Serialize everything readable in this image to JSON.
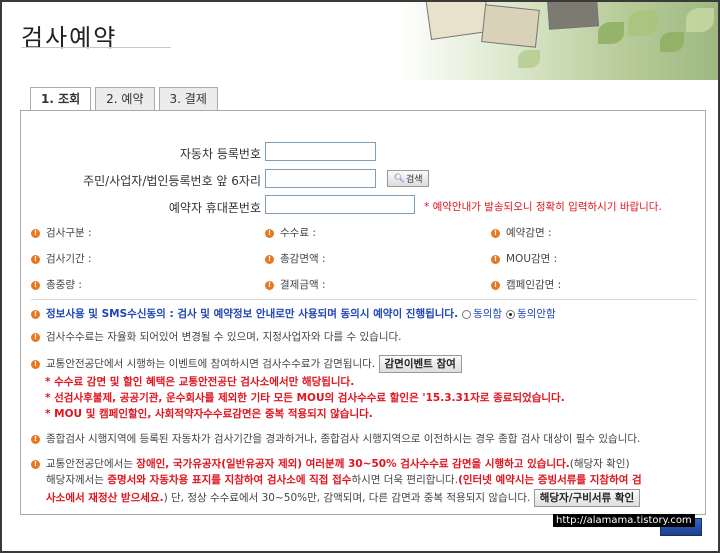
{
  "page_title": "검사예약",
  "tabs": [
    "1. 조회",
    "2. 예약",
    "3. 결제"
  ],
  "form": {
    "car_reg_label": "자동차 등록번호",
    "id_label": "주민/사업자/법인등록번호 앞 6자리",
    "phone_label": "예약자 휴대폰번호",
    "search_button": "검색",
    "phone_note": "* 예약안내가 발송되오니 정확히 입력하시기 바랍니다."
  },
  "info": {
    "col1": [
      "검사구분 :",
      "검사기간 :",
      "총중량 :"
    ],
    "col2": [
      "수수료 :",
      "총감면액 :",
      "결제금액 :"
    ],
    "col3": [
      "예약감면 :",
      "MOU감면 :",
      "캠페인감면 :"
    ]
  },
  "consent": {
    "text": "정보사용 및 SMS수신동의 : 검사 및 예약정보 안내로만 사용되며 동의시 예약이 진행됩니다.",
    "agree": "동의함",
    "disagree": "동의안함"
  },
  "notices": {
    "fee": "검사수수료는 자율화 되어있어 변경될 수 있으며, 지정사업자와 다를 수 있습니다.",
    "event_text": "교통안전공단에서 시행하는 이벤트에 참여하시면 검사수수료가 감면됩니다.",
    "event_button": "감면이벤트 참여",
    "event_red1": "* 수수료 감면 및 할인 혜택은 교통안전공단 검사소에서만 해당됩니다.",
    "event_red2": "* 선검사후불제, 공공기관, 운수회사를 제외한 기타 모든 MOU의 검사수수료 할인은 '15.3.31자로 종료되었습니다.",
    "event_red3": "* MOU 및 캠페인할인, 사회적약자수수료감면은 중복 적용되지 않습니다.",
    "combined": "종합검사 시행지역에 등록된 자동차가 검사기간을 경과하거나, 종합검사 시행지역으로 이전하시는 경우 종합 검사 대상이 필수 있습니다.",
    "disc_a": "교통안전공단에서는 ",
    "disc_red": "장애인, 국가유공자(일반유공자 제외) 여러분께 30~50% 검사수수료 감면을 시행하고 있습니다.",
    "disc_b": "(해당자 확인)",
    "disc_c": "해당자께서는 ",
    "disc_red2": "증명서와 자동차용 표지를 지참하여 검사소에 직접 접수",
    "disc_d": "하시면 더욱 편리합니다.",
    "disc_red3": "(인터넷 예약시는 증빙서류를 지참하여 검",
    "disc_red4": "사소에서 재정산 받으세요.",
    "disc_e": ") 단, 정상 수수료에서 30~50%만, 감액되며, 다른 감면과 중복 적용되지 않습니다.",
    "disc_button": "해당자/구비서류 확인"
  },
  "watermark": "http://alamama.tistory.com"
}
